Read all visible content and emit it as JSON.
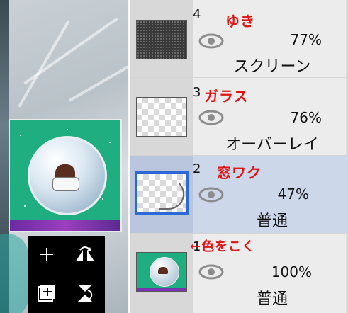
{
  "toolbox": {
    "icons": [
      "add-layer-icon",
      "flip-layer-icon",
      "add-folder-icon",
      "merge-down-icon"
    ]
  },
  "layers": [
    {
      "number": "4",
      "annotation": "ゆき",
      "opacity": "77%",
      "blend": "スクリーン",
      "thumbnail": "noise",
      "selected": false
    },
    {
      "number": "3",
      "annotation": "ガラス",
      "opacity": "76%",
      "blend": "オーバーレイ",
      "thumbnail": "transparent",
      "selected": false
    },
    {
      "number": "2",
      "annotation": "窓ワク",
      "opacity": "47%",
      "blend": "普通",
      "thumbnail": "arc",
      "selected": true
    },
    {
      "number": "1",
      "annotation": "←色をこく",
      "opacity": "100%",
      "blend": "普通",
      "thumbnail": "image",
      "selected": false
    }
  ],
  "colors": {
    "selected_row": "#ccd7ea",
    "selected_frame": "#2a69d6",
    "annotation": "#e01515"
  }
}
